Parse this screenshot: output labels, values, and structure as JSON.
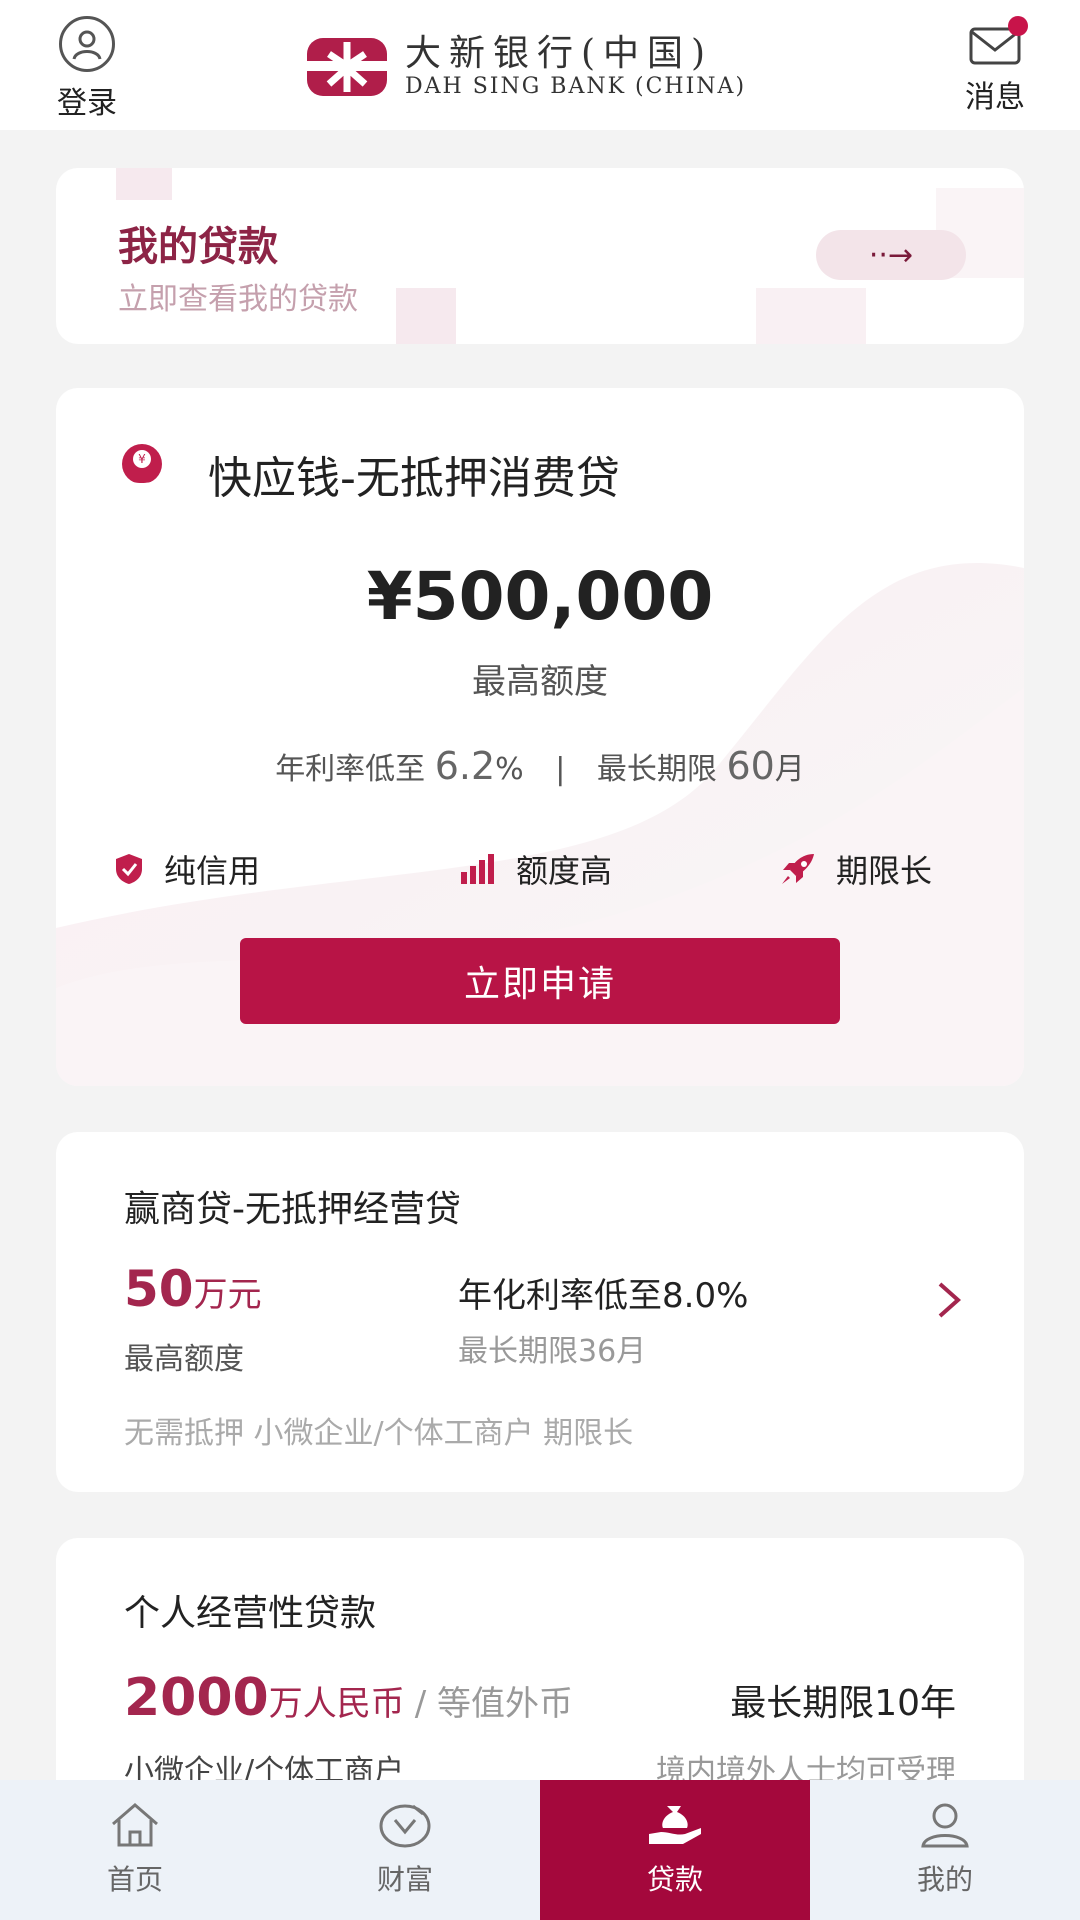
{
  "header": {
    "login_label": "登录",
    "messages_label": "消息",
    "logo_cn": "大新银行(中国)",
    "logo_en": "DAH SING BANK (CHINA)"
  },
  "my_loan": {
    "title": "我的贷款",
    "subtitle": "立即查看我的贷款",
    "arrow": "··→"
  },
  "kuaiyingqian": {
    "title": "快应钱-无抵押消费贷",
    "amount": "¥500,000",
    "amount_label": "最高额度",
    "rate_prefix": "年利率低至",
    "rate_value": "6.2",
    "rate_unit": "%",
    "separator": "|",
    "term_prefix": "最长期限",
    "term_value": "60",
    "term_unit": "月",
    "features": [
      "纯信用",
      "额度高",
      "期限长"
    ],
    "apply_label": "立即申请"
  },
  "yingshangdai": {
    "title": "赢商贷-无抵押经营贷",
    "amount_num": "50",
    "amount_unit": "万元",
    "amount_label": "最高额度",
    "rate": "年化利率低至8.0%",
    "term": "最长期限36月",
    "tags": "无需抵押 小微企业/个体工商户 期限长"
  },
  "personal_business": {
    "title": "个人经营性贷款",
    "amount_num": "2000",
    "amount_unit": "万人民币",
    "amount_alt": "/ 等值外币",
    "term": "最长期限10年",
    "left_note": "小微企业/个体工商户",
    "right_note": "境内境外人士均可受理"
  },
  "bottom_nav": {
    "items": [
      "首页",
      "财富",
      "贷款",
      "我的"
    ],
    "active": "贷款"
  },
  "colors": {
    "brand": "#b81446",
    "nav_active": "#a4083c",
    "accent_text": "#a3264e"
  }
}
